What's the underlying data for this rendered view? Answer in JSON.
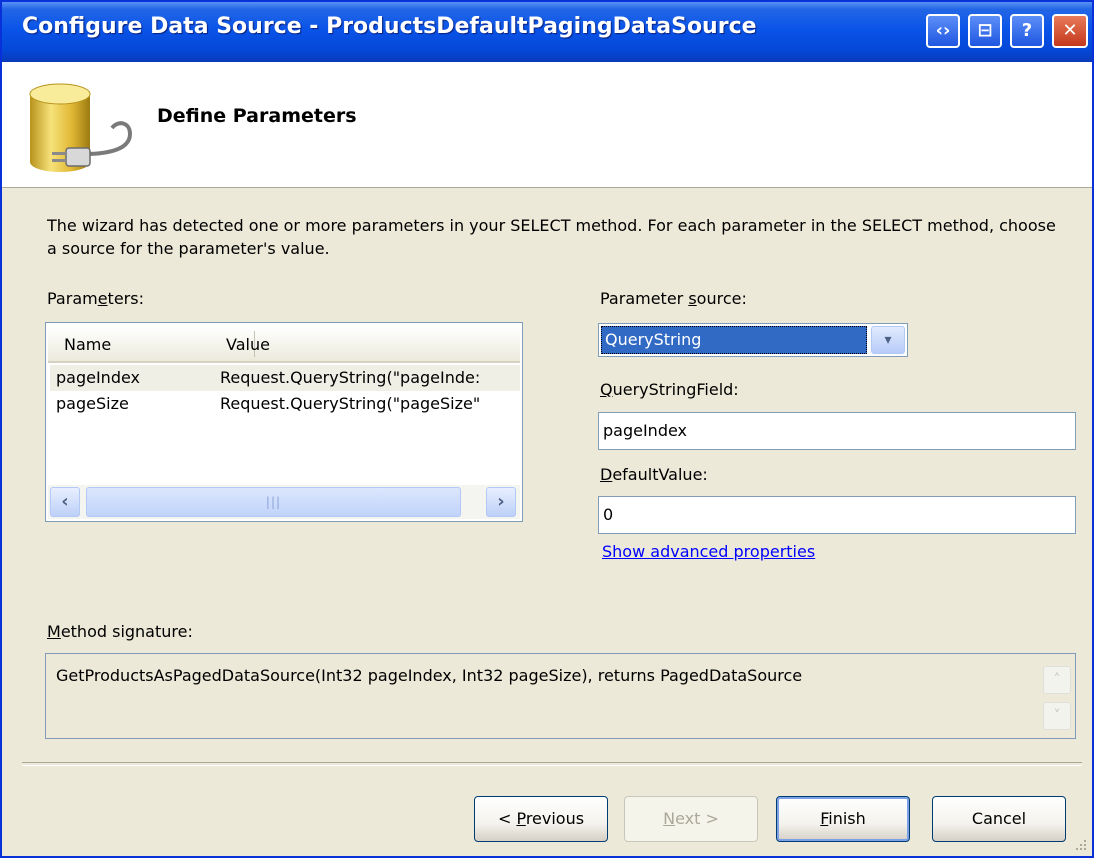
{
  "window": {
    "title": "Configure Data Source - ProductsDefaultPagingDataSource",
    "controls": {
      "nav_glyph": "‹›",
      "restore_glyph": "⊟",
      "help_glyph": "?",
      "close_glyph": "✕"
    }
  },
  "header": {
    "icon": "database-plug-icon",
    "title": "Define Parameters"
  },
  "description": "The wizard has detected one or more parameters in your SELECT method. For each parameter in the SELECT method, choose a source for the parameter's value.",
  "parameters": {
    "label_pre": "Param",
    "label_u": "e",
    "label_post": "ters:",
    "columns": [
      "Name",
      "Value"
    ],
    "rows": [
      {
        "name": "pageIndex",
        "value": "Request.QueryString(\"pageInde:"
      },
      {
        "name": "pageSize",
        "value": "Request.QueryString(\"pageSize\""
      }
    ],
    "scroll_thumb_glyph": "|||"
  },
  "parameter_source": {
    "label_pre": "Parameter ",
    "label_u": "s",
    "label_post": "ource:",
    "selected": "QueryString",
    "dropdown_glyph": "⌄"
  },
  "querystring_field": {
    "label_u": "Q",
    "label_post": "ueryStringField:",
    "value": "pageIndex"
  },
  "default_value": {
    "label_u": "D",
    "label_post": "efaultValue:",
    "value": "0"
  },
  "advanced_link": "Show advanced properties",
  "method_signature": {
    "label_u": "M",
    "label_post": "ethod signature:",
    "text": "GetProductsAsPagedDataSource(Int32 pageIndex, Int32 pageSize), returns PagedDataSource",
    "up_glyph": "˄",
    "down_glyph": "˅"
  },
  "buttons": {
    "previous_pre": "< ",
    "previous_u": "P",
    "previous_post": "revious",
    "next_u": "N",
    "next_post": "ext >",
    "finish_u": "F",
    "finish_post": "inish",
    "cancel": "Cancel"
  },
  "colors": {
    "titlebar": "#0a54e8",
    "selection": "#316ac5",
    "link": "#0000ff",
    "dialog_bg": "#ece9d8"
  }
}
